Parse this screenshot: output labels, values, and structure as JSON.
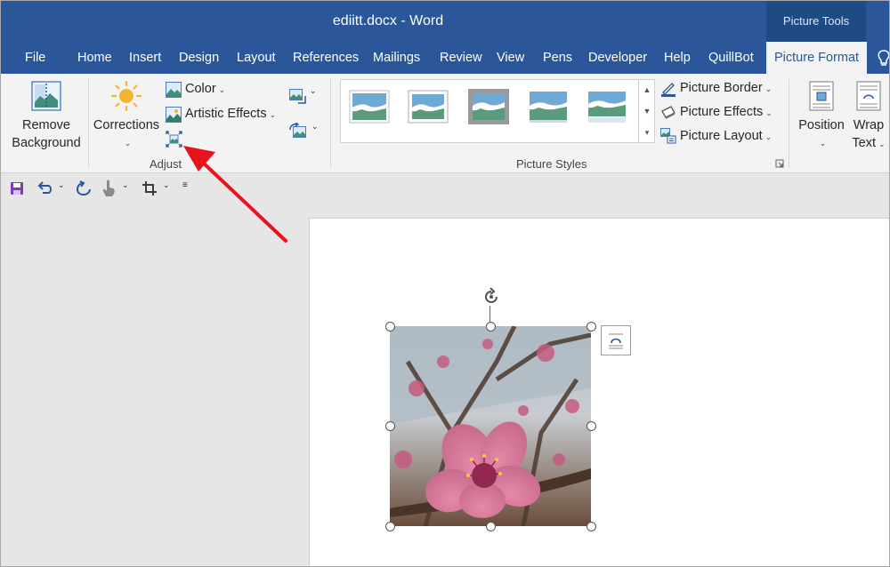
{
  "window": {
    "title": "ediitt.docx  -  Word",
    "context_group": "Picture Tools"
  },
  "tabs": [
    "File",
    "Home",
    "Insert",
    "Design",
    "Layout",
    "References",
    "Mailings",
    "Review",
    "View",
    "Pens",
    "Developer",
    "Help",
    "QuillBot",
    "Picture Format"
  ],
  "active_tab": "Picture Format",
  "ribbon": {
    "remove_background": {
      "line1": "Remove",
      "line2": "Background"
    },
    "corrections": "Corrections",
    "color": "Color",
    "artistic_effects": "Artistic Effects",
    "adjust_group": "Adjust",
    "picture_border": "Picture Border",
    "picture_effects": "Picture Effects",
    "picture_layout": "Picture Layout",
    "picture_styles_group": "Picture Styles",
    "position": "Position",
    "wrap_text": {
      "line1": "Wrap",
      "line2": "Text"
    }
  },
  "colors": {
    "accent": "#2b579a",
    "arrow": "#e8141d"
  }
}
